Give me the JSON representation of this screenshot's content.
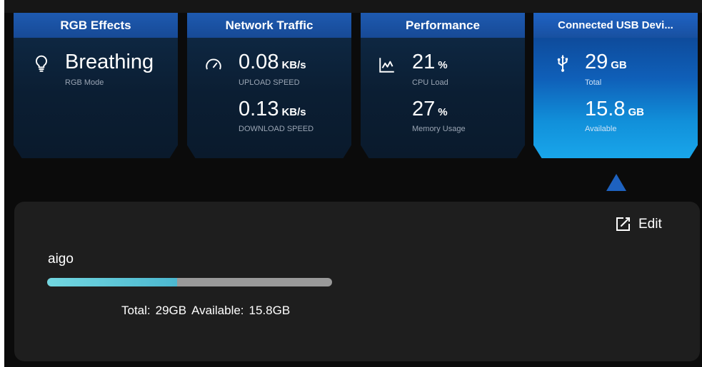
{
  "cards": {
    "rgb": {
      "title": "RGB Effects",
      "mode_value": "Breathing",
      "mode_label": "RGB Mode",
      "icon": "lightbulb-icon"
    },
    "network": {
      "title": "Network Traffic",
      "upload_value": "0.08",
      "upload_unit": "KB/s",
      "upload_label": "UPLOAD SPEED",
      "download_value": "0.13",
      "download_unit": "KB/s",
      "download_label": "DOWNLOAD SPEED",
      "icon": "speedometer-icon"
    },
    "performance": {
      "title": "Performance",
      "cpu_value": "21",
      "cpu_unit": "%",
      "cpu_label": "CPU Load",
      "mem_value": "27",
      "mem_unit": "%",
      "mem_label": "Memory Usage",
      "icon": "line-chart-icon"
    },
    "usb": {
      "title": "Connected USB Devi...",
      "total_value": "29",
      "total_unit": "GB",
      "total_label": "Total",
      "available_value": "15.8",
      "available_unit": "GB",
      "available_label": "Available",
      "icon": "usb-icon"
    }
  },
  "device_panel": {
    "edit_label": "Edit",
    "device_name": "aigo",
    "usage_fraction": 0.455,
    "total_label": "Total:",
    "total_value": "29GB",
    "available_label": "Available:",
    "available_value": "15.8GB"
  },
  "colors": {
    "accent": "#1e62c0",
    "bar_fill": "#5cc8d8",
    "bar_track": "#9a9a9a",
    "panel_bg": "#1e1e1e"
  }
}
